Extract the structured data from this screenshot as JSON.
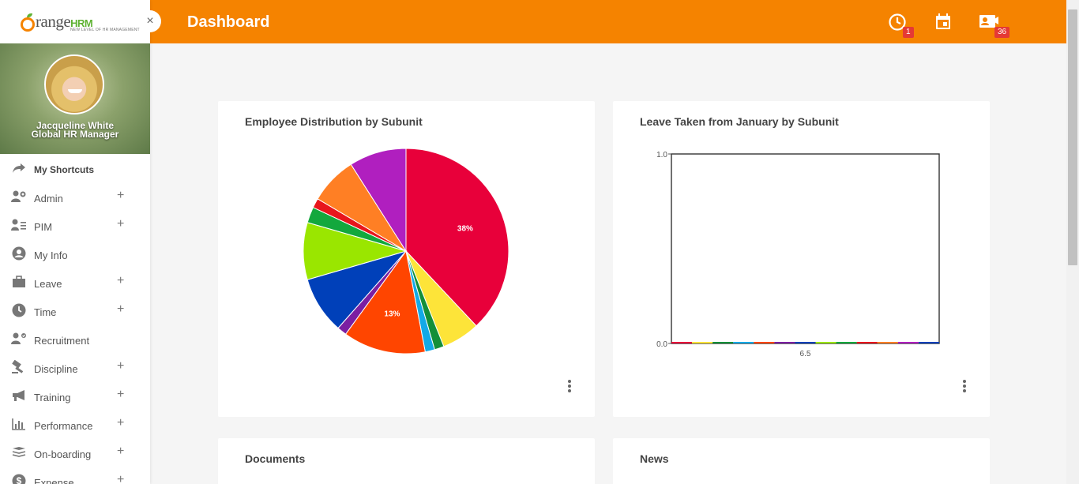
{
  "app": {
    "logo_text": "range",
    "logo_hrm": "HRM",
    "logo_tagline": "NEW LEVEL OF HR MANAGEMENT"
  },
  "user": {
    "name": "Jacqueline White",
    "role": "Global HR Manager"
  },
  "sidebar": {
    "items": [
      {
        "label": "My Shortcuts",
        "icon": "share-arrow-icon",
        "expandable": false
      },
      {
        "label": "Admin",
        "icon": "user-gear-icon",
        "expandable": true
      },
      {
        "label": "PIM",
        "icon": "user-list-icon",
        "expandable": true
      },
      {
        "label": "My Info",
        "icon": "user-circle-icon",
        "expandable": false
      },
      {
        "label": "Leave",
        "icon": "briefcase-icon",
        "expandable": true
      },
      {
        "label": "Time",
        "icon": "clock-icon",
        "expandable": true
      },
      {
        "label": "Recruitment",
        "icon": "user-check-icon",
        "expandable": false
      },
      {
        "label": "Discipline",
        "icon": "gavel-icon",
        "expandable": true
      },
      {
        "label": "Training",
        "icon": "megaphone-icon",
        "expandable": true
      },
      {
        "label": "Performance",
        "icon": "bar-chart-icon",
        "expandable": true
      },
      {
        "label": "On-boarding",
        "icon": "layers-icon",
        "expandable": true
      },
      {
        "label": "Expense",
        "icon": "dollar-icon",
        "expandable": true
      }
    ],
    "plus_symbol": "+"
  },
  "header": {
    "title": "Dashboard",
    "close_symbol": "×",
    "attendance_badge": "1",
    "contacts_badge": "36"
  },
  "cards": {
    "distribution_title": "Employee Distribution by Subunit",
    "leave_title": "Leave Taken from January by Subunit",
    "documents_title": "Documents",
    "news_title": "News"
  },
  "chart_data": [
    {
      "type": "pie",
      "title": "Employee Distribution by Subunit",
      "values": [
        38,
        6,
        1.5,
        1.5,
        13,
        1.5,
        9,
        9,
        2.5,
        1.5,
        7.5,
        9
      ],
      "colors": [
        "#e8003a",
        "#fde439",
        "#138f39",
        "#13a9e6",
        "#ff4500",
        "#7b1fa2",
        "#0040b9",
        "#9ae600",
        "#13a83d",
        "#e8161c",
        "#ff7f24",
        "#b01fbf"
      ],
      "labels": [
        "38%",
        "",
        "",
        "",
        "13%",
        "",
        "",
        "",
        "",
        "",
        "",
        ""
      ]
    },
    {
      "type": "bar",
      "title": "Leave Taken from January by Subunit",
      "x_tick": "6.5",
      "y_ticks": [
        "0.0",
        "1.0"
      ],
      "ylim": [
        0,
        1
      ],
      "values": [
        0,
        0,
        0,
        0,
        0,
        0,
        0,
        0,
        0,
        0,
        0,
        0
      ],
      "colors": [
        "#e8003a",
        "#fde439",
        "#138f39",
        "#13a9e6",
        "#ff4500",
        "#7b1fa2",
        "#0040b9",
        "#9ae600",
        "#13a83d",
        "#e8161c",
        "#ff7f24",
        "#b01fbf",
        "#0040b9"
      ]
    }
  ]
}
